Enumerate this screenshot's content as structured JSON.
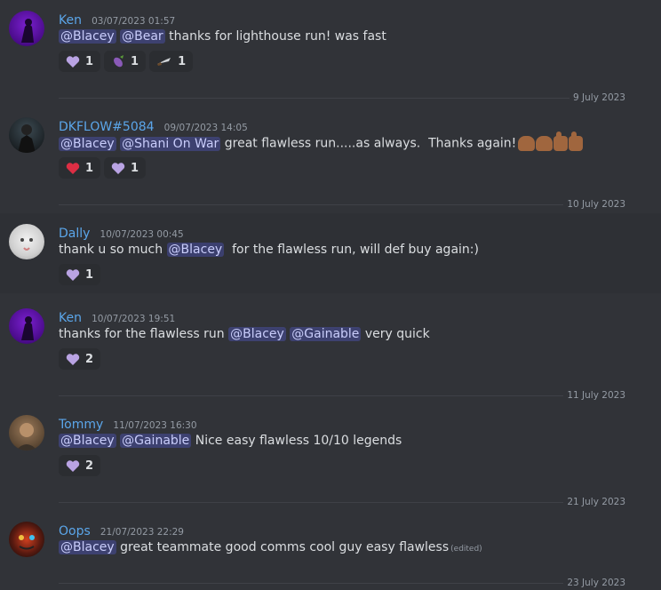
{
  "messages": [
    {
      "author": "Ken",
      "time": "03/07/2023 01:57",
      "content": [
        {
          "m": "@Blacey"
        },
        {
          "t": " "
        },
        {
          "m": "@Bear"
        },
        {
          "t": " thanks for lighthouse run! was fast"
        }
      ],
      "reactions": [
        {
          "icon": "purple-heart-icon",
          "count": "1"
        },
        {
          "icon": "eggplant-icon",
          "count": "1"
        },
        {
          "icon": "knife-icon",
          "count": "1"
        }
      ]
    },
    {
      "author": "DKFLOW#5084",
      "time": "09/07/2023 14:05",
      "content": [
        {
          "m": "@Blacey"
        },
        {
          "t": " "
        },
        {
          "m": "@Shani On War"
        },
        {
          "t": " great flawless run.....as always.  Thanks again!"
        }
      ],
      "reactions": [
        {
          "icon": "red-heart-icon",
          "count": "1"
        },
        {
          "icon": "purple-heart-icon",
          "count": "1"
        }
      ]
    },
    {
      "author": "Dally",
      "time": "10/07/2023 00:45",
      "content": [
        {
          "t": "thank u so much "
        },
        {
          "m": "@Blacey"
        },
        {
          "t": "  for the flawless run, will def buy again:)"
        }
      ],
      "reactions": [
        {
          "icon": "purple-heart-icon",
          "count": "1"
        }
      ]
    },
    {
      "author": "Ken",
      "time": "10/07/2023 19:51",
      "content": [
        {
          "t": "thanks for the flawless run "
        },
        {
          "m": "@Blacey"
        },
        {
          "t": " "
        },
        {
          "m": "@Gainable"
        },
        {
          "t": " very quick"
        }
      ],
      "reactions": [
        {
          "icon": "purple-heart-icon",
          "count": "2"
        }
      ]
    },
    {
      "author": "Tommy",
      "time": "11/07/2023 16:30",
      "content": [
        {
          "m": "@Blacey"
        },
        {
          "t": " "
        },
        {
          "m": "@Gainable"
        },
        {
          "t": " Nice easy flawless 10/10 legends"
        }
      ],
      "reactions": [
        {
          "icon": "purple-heart-icon",
          "count": "2"
        }
      ]
    },
    {
      "author": "Oops",
      "time": "21/07/2023 22:29",
      "content": [
        {
          "m": "@Blacey"
        },
        {
          "t": " great teammate good comms cool guy easy flawless"
        }
      ],
      "edited": "(edited)",
      "reactions": []
    }
  ],
  "dividers": [
    "9 July 2023",
    "10 July 2023",
    "11 July 2023",
    "21 July 2023",
    "23 July 2023"
  ],
  "colors": {
    "mention_bg": "#3c4270",
    "name": "#5ba6ea",
    "background": "#313338"
  }
}
